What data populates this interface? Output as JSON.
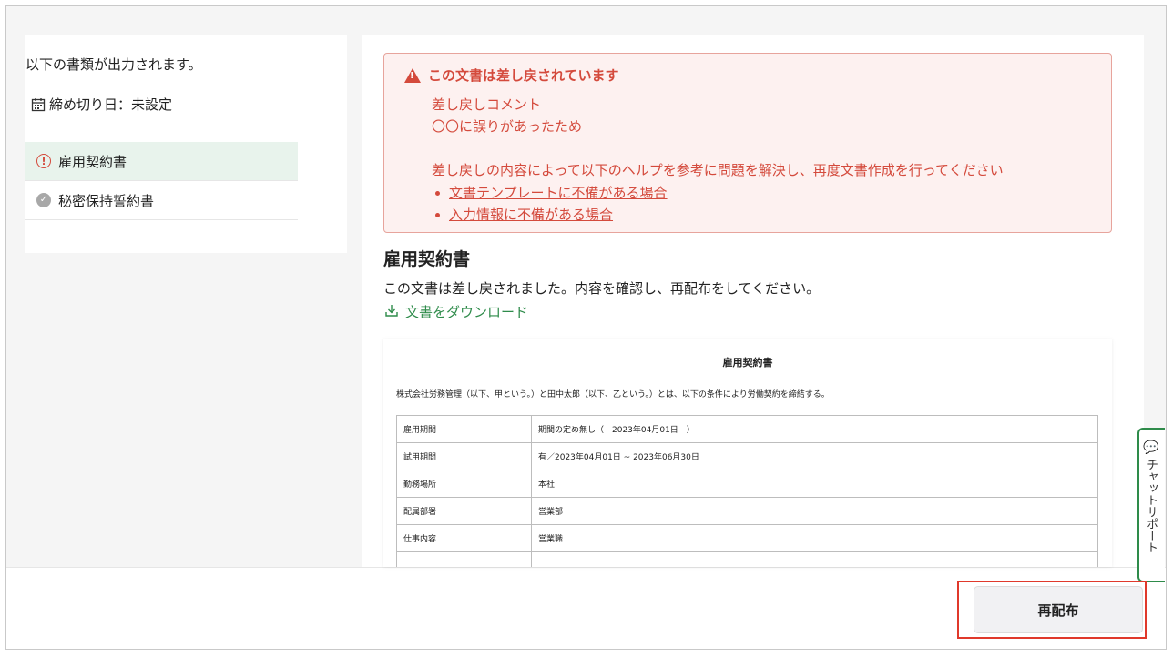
{
  "sidebar": {
    "intro_text": "以下の書類が出力されます。",
    "deadline_label": "締め切り日：未設定",
    "calendar_icon": "calendar-icon",
    "documents": [
      {
        "label": "雇用契約書",
        "status_icon": "warning-circle-icon",
        "active": true
      },
      {
        "label": "秘密保持誓約書",
        "status_icon": "check-circle-icon",
        "active": false
      }
    ]
  },
  "alert": {
    "title": "この文書は差し戻されています",
    "comment_heading": "差し戻しコメント",
    "comment_body": "〇〇に誤りがあったため",
    "help_text": "差し戻しの内容によって以下のヘルプを参考に問題を解決し、再度文書作成を行ってください",
    "links": [
      "文書テンプレートに不備がある場合",
      "入力情報に不備がある場合"
    ],
    "color": "#d44a3c"
  },
  "document": {
    "title": "雇用契約書",
    "description": "この文書は差し戻されました。内容を確認し、再配布をしてください。",
    "download_label": "文書をダウンロード",
    "accent_color": "#2e8b4a"
  },
  "preview": {
    "title": "雇用契約書",
    "intro": "株式会社労務管理（以下、甲という。）と田中太郎（以下、乙という。）とは、以下の条件により労働契約を締結する。",
    "rows": [
      {
        "key": "雇用期間",
        "value": "期間の定め無し（　2023年04月01日　）"
      },
      {
        "key": "試用期間",
        "value": "有／2023年04月01日 ~ 2023年06月30日"
      },
      {
        "key": "勤務場所",
        "value": "本社"
      },
      {
        "key": "配属部署",
        "value": "営業部"
      },
      {
        "key": "仕事内容",
        "value": "営業職"
      }
    ]
  },
  "chat": {
    "icon": "chat-bubble-icon",
    "label": "チャットサポート"
  },
  "actions": {
    "redistribute_label": "再配布"
  }
}
